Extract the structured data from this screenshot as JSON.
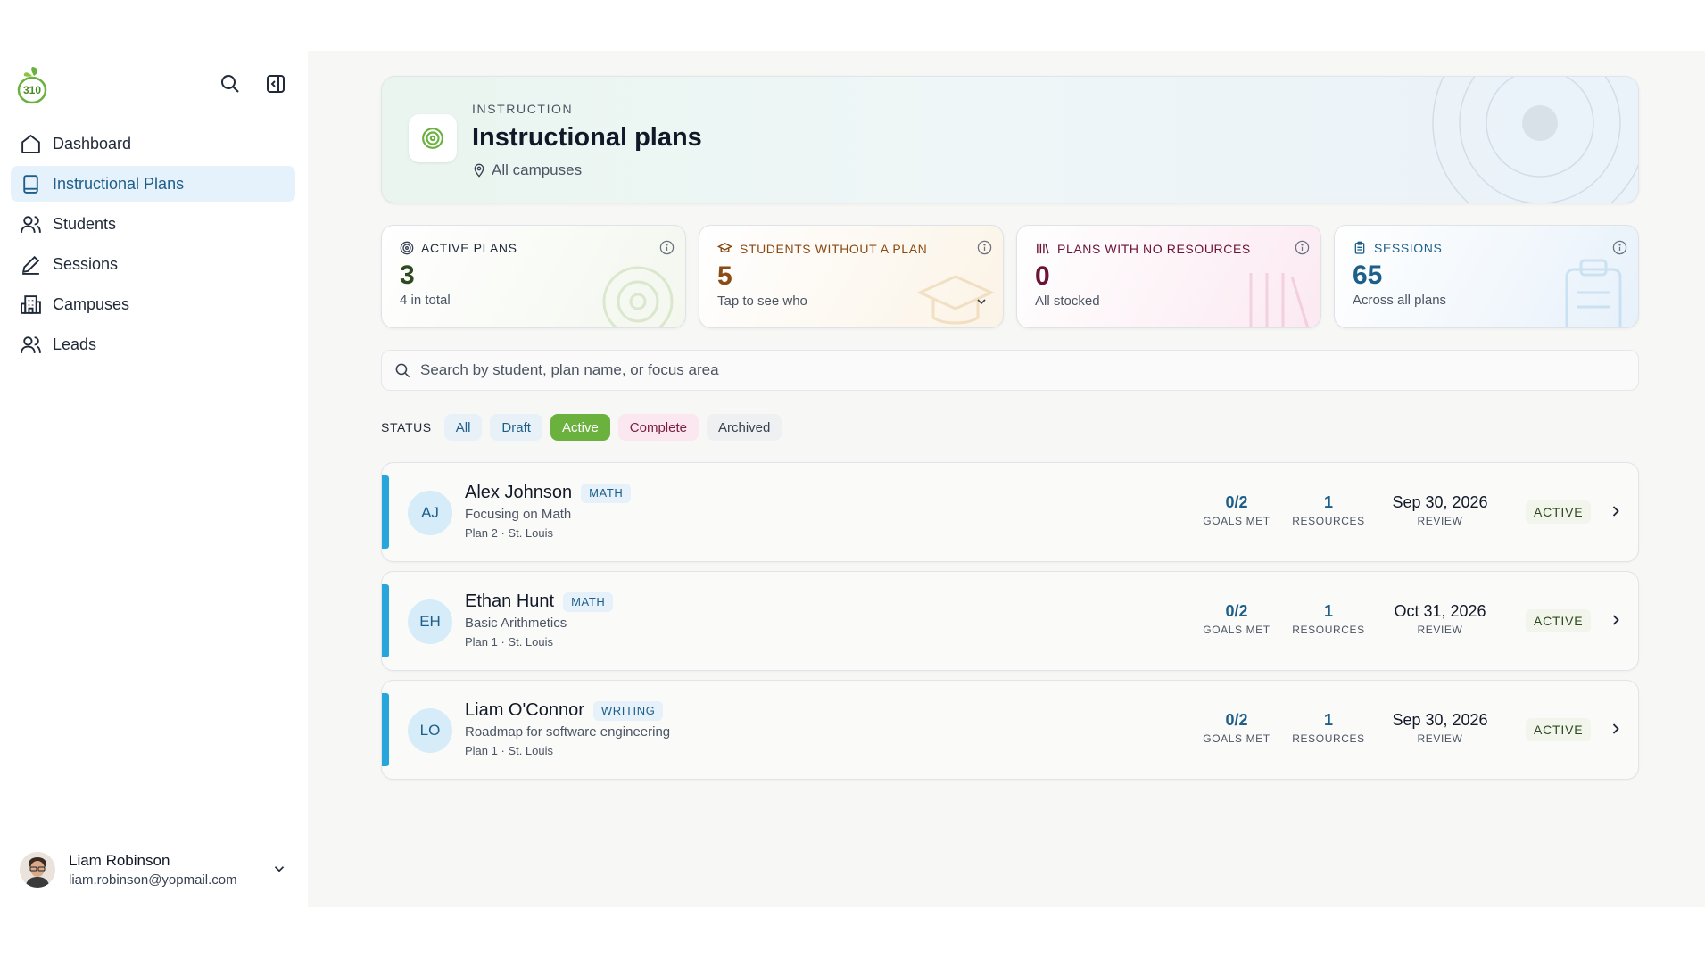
{
  "sidebar": {
    "items": [
      {
        "label": "Dashboard",
        "icon": "home-icon"
      },
      {
        "label": "Instructional Plans",
        "icon": "book-icon",
        "active": true
      },
      {
        "label": "Students",
        "icon": "users-icon"
      },
      {
        "label": "Sessions",
        "icon": "pen-icon"
      },
      {
        "label": "Campuses",
        "icon": "building-icon"
      },
      {
        "label": "Leads",
        "icon": "users-icon"
      }
    ],
    "user": {
      "name": "Liam Robinson",
      "email": "liam.robinson@yopmail.com"
    }
  },
  "header": {
    "eyebrow": "INSTRUCTION",
    "title": "Instructional plans",
    "location": "All campuses"
  },
  "stats": [
    {
      "label": "ACTIVE PLANS",
      "value": "3",
      "sub": "4 in total",
      "color": "#2f4a1e"
    },
    {
      "label": "STUDENTS WITHOUT A PLAN",
      "value": "5",
      "sub": "Tap to see who",
      "color": "#8a4b14"
    },
    {
      "label": "PLANS WITH NO RESOURCES",
      "value": "0",
      "sub": "All stocked",
      "color": "#6b1235"
    },
    {
      "label": "SESSIONS",
      "value": "65",
      "sub": "Across all plans",
      "color": "#1e5f8a"
    }
  ],
  "search": {
    "placeholder": "Search by student, plan name, or focus area"
  },
  "filters": {
    "label": "STATUS",
    "options": [
      "All",
      "Draft",
      "Active",
      "Complete",
      "Archived"
    ],
    "selected": "Active"
  },
  "plans": [
    {
      "initials": "AJ",
      "name": "Alex Johnson",
      "tag": "MATH",
      "focus": "Focusing on Math",
      "meta": "Plan 2 · St. Louis",
      "goals": "0/2",
      "goals_label": "GOALS MET",
      "resources": "1",
      "resources_label": "RESOURCES",
      "review": "Sep 30, 2026",
      "review_label": "REVIEW",
      "status": "ACTIVE"
    },
    {
      "initials": "EH",
      "name": "Ethan Hunt",
      "tag": "MATH",
      "focus": "Basic Arithmetics",
      "meta": "Plan 1 · St. Louis",
      "goals": "0/2",
      "goals_label": "GOALS MET",
      "resources": "1",
      "resources_label": "RESOURCES",
      "review": "Oct 31, 2026",
      "review_label": "REVIEW",
      "status": "ACTIVE"
    },
    {
      "initials": "LO",
      "name": "Liam O'Connor",
      "tag": "WRITING",
      "focus": "Roadmap for software engineering",
      "meta": "Plan 1 · St. Louis",
      "goals": "0/2",
      "goals_label": "GOALS MET",
      "resources": "1",
      "resources_label": "RESOURCES",
      "review": "Sep 30, 2026",
      "review_label": "REVIEW",
      "status": "ACTIVE"
    }
  ],
  "colors": {
    "accent": "#1e5f8a",
    "active_chip": "#6ab13e",
    "plan_bar": "#27a6db"
  }
}
